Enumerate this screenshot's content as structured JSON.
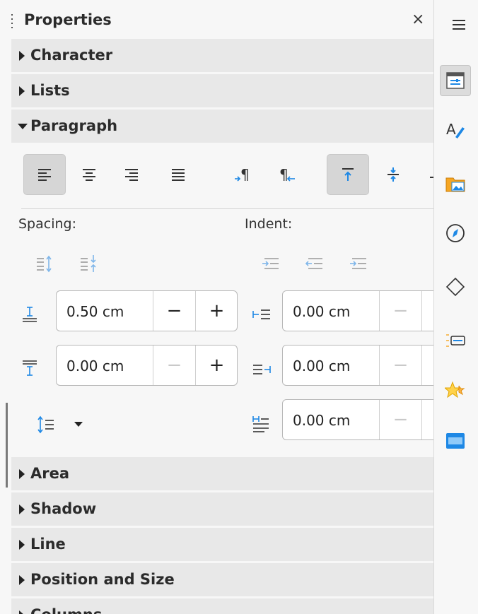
{
  "panel": {
    "title": "Properties",
    "close_glyph": "×"
  },
  "sections": {
    "character": "Character",
    "lists": "Lists",
    "paragraph": "Paragraph",
    "area": "Area",
    "shadow": "Shadow",
    "line": "Line",
    "position_size": "Position and Size",
    "columns": "Columns"
  },
  "paragraph": {
    "spacing_label": "Spacing:",
    "indent_label": "Indent:",
    "above_spacing": "0.50 cm",
    "below_spacing": "0.00 cm",
    "before_indent": "0.00 cm",
    "after_indent": "0.00 cm",
    "first_line_indent": "0.00 cm",
    "minus": "−",
    "plus": "+"
  },
  "colors": {
    "accent": "#1e88e5",
    "section_bg": "#e8e8e8",
    "selected_bg": "#d6d6d6"
  },
  "sidebar_tabs": [
    "menu-icon",
    "properties-icon",
    "styles-icon",
    "gallery-icon",
    "navigator-icon",
    "shapes-icon",
    "manage-changes-icon",
    "design-icon",
    "master-slides-icon"
  ]
}
